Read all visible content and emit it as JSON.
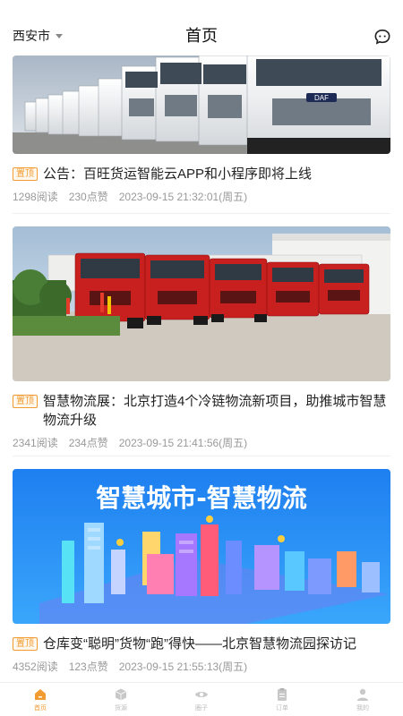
{
  "header": {
    "city": "西安市",
    "title": "首页"
  },
  "articles": [
    {
      "tag": "置顶",
      "title": "公告：百旺货运智能云APP和小程序即将上线",
      "reads": "1298阅读",
      "likes": "230点赞",
      "time": "2023-09-15 21:32:01(周五)"
    },
    {
      "tag": "置顶",
      "title": "智慧物流展：北京打造4个冷链物流新项目，助推城市智慧物流升级",
      "reads": "2341阅读",
      "likes": "234点赞",
      "time": "2023-09-15 21:41:56(周五)"
    },
    {
      "tag": "置顶",
      "title": "仓库变“聪明”货物“跑”得快——北京智慧物流园探访记",
      "reads": "4352阅读",
      "likes": "123点赞",
      "time": "2023-09-15 21:55:13(周五)",
      "banner_text": "智慧城市-智慧物流"
    }
  ],
  "tabbar": {
    "items": [
      {
        "label": "首页",
        "icon": "home-icon",
        "active": true
      },
      {
        "label": "货源",
        "icon": "cube-icon",
        "active": false
      },
      {
        "label": "圈子",
        "icon": "eye-icon",
        "active": false
      },
      {
        "label": "订单",
        "icon": "clipboard-icon",
        "active": false
      },
      {
        "label": "我的",
        "icon": "user-icon",
        "active": false
      }
    ],
    "active_color": "#f29b30",
    "inactive_color": "#c8c8c8"
  },
  "colors": {
    "accent": "#f29b30",
    "meta_text": "#999999",
    "banner_blue": "#1e7ff0"
  }
}
